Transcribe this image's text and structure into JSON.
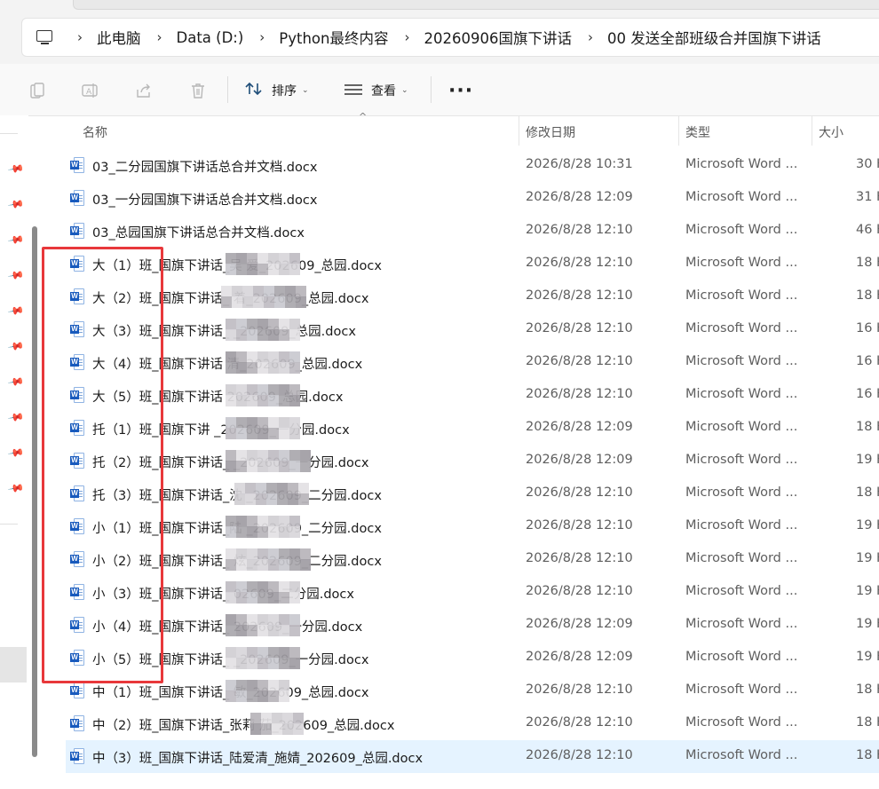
{
  "breadcrumb": [
    "此电脑",
    "Data (D:)",
    "Python最终内容",
    "20260906国旗下讲话",
    "00 发送全部班级合并国旗下讲话"
  ],
  "toolbar": {
    "copy_icon": "copy-icon",
    "rename_icon": "rename-icon",
    "share_icon": "share-icon",
    "delete_icon": "trash-icon",
    "sort_label": "排序",
    "view_label": "查看",
    "more_label": "···"
  },
  "columns": {
    "name": "名称",
    "date": "修改日期",
    "type": "类型",
    "size": "大小"
  },
  "files": [
    {
      "name": "03_二分园国旗下讲话总合并文档.docx",
      "date": "2026/8/28 10:31",
      "type": "Microsoft Word ...",
      "size": "30 K"
    },
    {
      "name": "03_一分园国旗下讲话总合并文档.docx",
      "date": "2026/8/28 12:09",
      "type": "Microsoft Word ...",
      "size": "31 K"
    },
    {
      "name": "03_总园国旗下讲话总合并文档.docx",
      "date": "2026/8/28 12:10",
      "type": "Microsoft Word ...",
      "size": "46 K"
    },
    {
      "name": "大（1）班_国旗下讲话_吴        爱_202609_总园.docx",
      "date": "2026/8/28 12:10",
      "type": "Microsoft Word ...",
      "size": "18 K"
    },
    {
      "name": "大（2）班_国旗下讲话_         着_202609_总园.docx",
      "date": "2026/8/28 12:10",
      "type": "Microsoft Word ...",
      "size": "18 K"
    },
    {
      "name": "大（3）班_国旗下讲话_          _202609_总园.docx",
      "date": "2026/8/28 12:10",
      "type": "Microsoft Word ...",
      "size": "16 K"
    },
    {
      "name": "大（4）班_国旗下讲话          清_202609_总园.docx",
      "date": "2026/8/28 12:10",
      "type": "Microsoft Word ...",
      "size": "16 K"
    },
    {
      "name": "大（5）班_国旗下讲话         202609_总园.docx",
      "date": "2026/8/28 12:10",
      "type": "Microsoft Word ...",
      "size": "16 K"
    },
    {
      "name": "托（1）班_国旗下讲           _202609_一分园.docx",
      "date": "2026/8/28 12:09",
      "type": "Microsoft Word ...",
      "size": "18 K"
    },
    {
      "name": "托（2）班_国旗下讲话_          _202609_一分园.docx",
      "date": "2026/8/28 12:09",
      "type": "Microsoft Word ...",
      "size": "19 K"
    },
    {
      "name": "托（3）班_国旗下讲话_沈         _202609_二分园.docx",
      "date": "2026/8/28 12:10",
      "type": "Microsoft Word ...",
      "size": "18 K"
    },
    {
      "name": "小（1）班_国旗下讲话_陆         _202609_二分园.docx",
      "date": "2026/8/28 12:10",
      "type": "Microsoft Word ...",
      "size": "19 K"
    },
    {
      "name": "小（2）班_国旗下讲话_         炫_202609_二分园.docx",
      "date": "2026/8/28 12:10",
      "type": "Microsoft Word ...",
      "size": "19 K"
    },
    {
      "name": "小（3）班_国旗下讲话_          02609_二分园.docx",
      "date": "2026/8/28 12:10",
      "type": "Microsoft Word ...",
      "size": "19 K"
    },
    {
      "name": "小（4）班_国旗下讲话_          202609_一分园.docx",
      "date": "2026/8/28 12:09",
      "type": "Microsoft Word ...",
      "size": "19 K"
    },
    {
      "name": "小（5）班_国旗下讲话_          _202609_一分园.docx",
      "date": "2026/8/28 12:09",
      "type": "Microsoft Word ...",
      "size": "19 K"
    },
    {
      "name": "中（1）班_国旗下讲话_       敏_202609_总园.docx",
      "date": "2026/8/28 12:10",
      "type": "Microsoft Word ...",
      "size": "18 K"
    },
    {
      "name": "中（2）班_国旗下讲话_张莉       茄_202609_总园.docx",
      "date": "2026/8/28 12:10",
      "type": "Microsoft Word ...",
      "size": "18 K"
    },
    {
      "name": "中（3）班_国旗下讲话_陆爱清_施婧_202609_总园.docx",
      "date": "2026/8/28 12:10",
      "type": "Microsoft Word ...",
      "size": "18 K"
    }
  ],
  "colors": {
    "selected_row": "#e5f3ff",
    "annotation": "#e8383b",
    "word_blue": "#185abd"
  }
}
